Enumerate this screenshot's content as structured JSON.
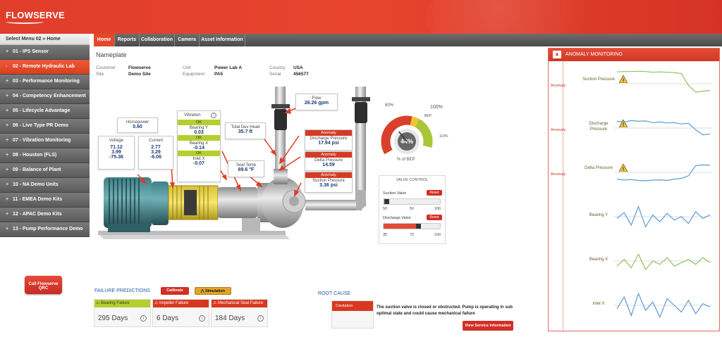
{
  "app": {
    "logo": "FLOWSERVE"
  },
  "sidebar": {
    "header": "Select Menu 02 » Home",
    "call_button": "Call Flowserve QRC",
    "items": [
      {
        "prefix": "+",
        "label": "01 - IPS Sensor",
        "active": false
      },
      {
        "prefix": "-",
        "label": "02 - Remote Hydraulic Lab",
        "active": true
      },
      {
        "prefix": "+",
        "label": "03 - Performance Monitoring",
        "active": false
      },
      {
        "prefix": "+",
        "label": "04 - Competency Enhancement",
        "active": false
      },
      {
        "prefix": "+",
        "label": "05 - Lifecycle Advantage",
        "active": false
      },
      {
        "prefix": "+",
        "label": "06 - Live Type PR Demo",
        "active": false
      },
      {
        "prefix": "+",
        "label": "07 - Vibration Monitoring",
        "active": false
      },
      {
        "prefix": "+",
        "label": "08 - Houston (FLS)",
        "active": false
      },
      {
        "prefix": "+",
        "label": "09 - Balance of Plant",
        "active": false
      },
      {
        "prefix": "+",
        "label": "10 - NA Demo Units",
        "active": false
      },
      {
        "prefix": "+",
        "label": "11 - EMEA Demo Kits",
        "active": false
      },
      {
        "prefix": "+",
        "label": "12 - APAC Demo Kits",
        "active": false
      },
      {
        "prefix": "+",
        "label": "13 - Pump Performance Demo",
        "active": false
      }
    ]
  },
  "tabs": [
    "Home",
    "Reports",
    "Collaboration",
    "Camera",
    "Asset Information"
  ],
  "nameplate": {
    "title": "Nameplate",
    "customer_label": "Customer",
    "customer": "Flowserve",
    "site_label": "Site",
    "site": "Demo Site",
    "unit_label": "Unit",
    "unit": "Power Lab A",
    "equipment_label": "Equipment",
    "equipment": "PA5",
    "country_label": "Country",
    "country": "USA",
    "serial_label": "Serial",
    "serial": "456577"
  },
  "diagram": {
    "horsepower_label": "Horsepower",
    "horsepower": "0.60",
    "voltage_label": "Voltage",
    "voltage": [
      "71.12",
      "3.99",
      "-75.36"
    ],
    "current_label": "Current",
    "current": [
      "2.77",
      "3.29",
      "-6.06"
    ],
    "vibration_label": "Vibration",
    "ok_label": "OK",
    "bearing_y_label": "Bearing Y",
    "bearing_y": "0.03",
    "bearing_x_label": "Bearing X",
    "bearing_x": "-0.14",
    "inlet_x_label": "Inlet X",
    "inlet_x": "-0.07",
    "total_dev_head_label": "Total Dev Head",
    "total_dev_head": "35.7 ft",
    "seal_temp_label": "Seal Temp",
    "seal_temp": "89.6 °F",
    "flow_label": "Flow",
    "flow": "26.26 gpm",
    "anomaly_label": "Anomaly",
    "discharge_pressure_label": "Discharge Pressure",
    "discharge_pressure": "17.94 psi",
    "delta_pressure_label": "Delta Pressure",
    "delta_pressure": "14.59",
    "suction_pressure_label": "Suction Pressure",
    "suction_pressure": "3.36 psi"
  },
  "gauge": {
    "value_text": "44%",
    "value": 44,
    "label": "% of BEP",
    "label_80": "80%",
    "label_bep": "BEP",
    "label_100": "100%",
    "label_110": "110%"
  },
  "valve_control": {
    "title": "VALVE CONTROL",
    "reset_label": "Reset",
    "suction": {
      "label": "Suction Valve",
      "min": "50",
      "value": "50",
      "max": "100",
      "fraction": 0.0
    },
    "discharge": {
      "label": "Discharge Valve",
      "min": "35",
      "value": "75",
      "max": "100",
      "fraction": 0.615
    }
  },
  "failure_predictions": {
    "title": "FAILURE PREDICTIONS",
    "calibrate": "Calibrate",
    "simulation": "Simulation",
    "cards": [
      {
        "label": "Bearing Failure",
        "days": "295 Days",
        "color": "#b5cf2e",
        "text_color": "#333333"
      },
      {
        "label": "Impeller Failure",
        "days": "6 Days",
        "color": "#d8381f",
        "text_color": "#ffffff"
      },
      {
        "label": "Mechanical Seal Failure",
        "days": "184 Days",
        "color": "#d8381f",
        "text_color": "#ffffff"
      }
    ]
  },
  "root_cause": {
    "title": "ROOT CAUSE",
    "cause": "Cavitation",
    "description": "The suction valve is closed or obstructed. Pump is operating in sub optimal state and could cause mechanical failure",
    "button": "View Service Information"
  },
  "anomaly_monitoring": {
    "title": "ANOMALY MONITORING",
    "anomaly_label": "Anomaly",
    "sensors": [
      {
        "name": "Suction Pressure",
        "anomaly": true,
        "color": "#8fc15a",
        "values": [
          0.85,
          0.86,
          0.86,
          0.87,
          0.86,
          0.84,
          0.85,
          0.84,
          0.83,
          0.8,
          0.45,
          0.25,
          0.28,
          0.3
        ]
      },
      {
        "name": "Discharge Pressure",
        "anomaly": true,
        "color": "#5b9bd5",
        "values": [
          0.7,
          0.68,
          0.72,
          0.7,
          0.71,
          0.66,
          0.68,
          0.65,
          0.66,
          0.62,
          0.64,
          0.45,
          0.3,
          0.32
        ]
      },
      {
        "name": "Delta Pressure",
        "anomaly": true,
        "color": "#5b9bd5",
        "values": [
          0.3,
          0.27,
          0.29,
          0.26,
          0.25,
          0.27,
          0.28,
          0.26,
          0.3,
          0.32,
          0.4,
          0.7,
          0.72,
          0.71
        ]
      },
      {
        "name": "Bearing Y",
        "anomaly": false,
        "color": "#5b9bd5",
        "values": [
          0.45,
          0.62,
          0.25,
          0.8,
          0.2,
          0.55,
          0.35,
          0.6,
          0.4,
          0.5,
          0.3,
          0.65,
          0.45,
          0.55
        ]
      },
      {
        "name": "Bearing X",
        "anomaly": false,
        "color": "#8fc15a",
        "values": [
          0.35,
          0.55,
          0.3,
          0.7,
          0.25,
          0.5,
          0.4,
          0.6,
          0.35,
          0.45,
          0.55,
          0.4,
          0.6,
          0.45
        ]
      },
      {
        "name": "Inlet X",
        "anomaly": false,
        "color": "#5b9bd5",
        "values": [
          0.4,
          0.75,
          0.2,
          0.85,
          0.35,
          0.6,
          0.15,
          0.7,
          0.5,
          0.3,
          0.65,
          0.25,
          0.55,
          0.45
        ]
      }
    ]
  }
}
